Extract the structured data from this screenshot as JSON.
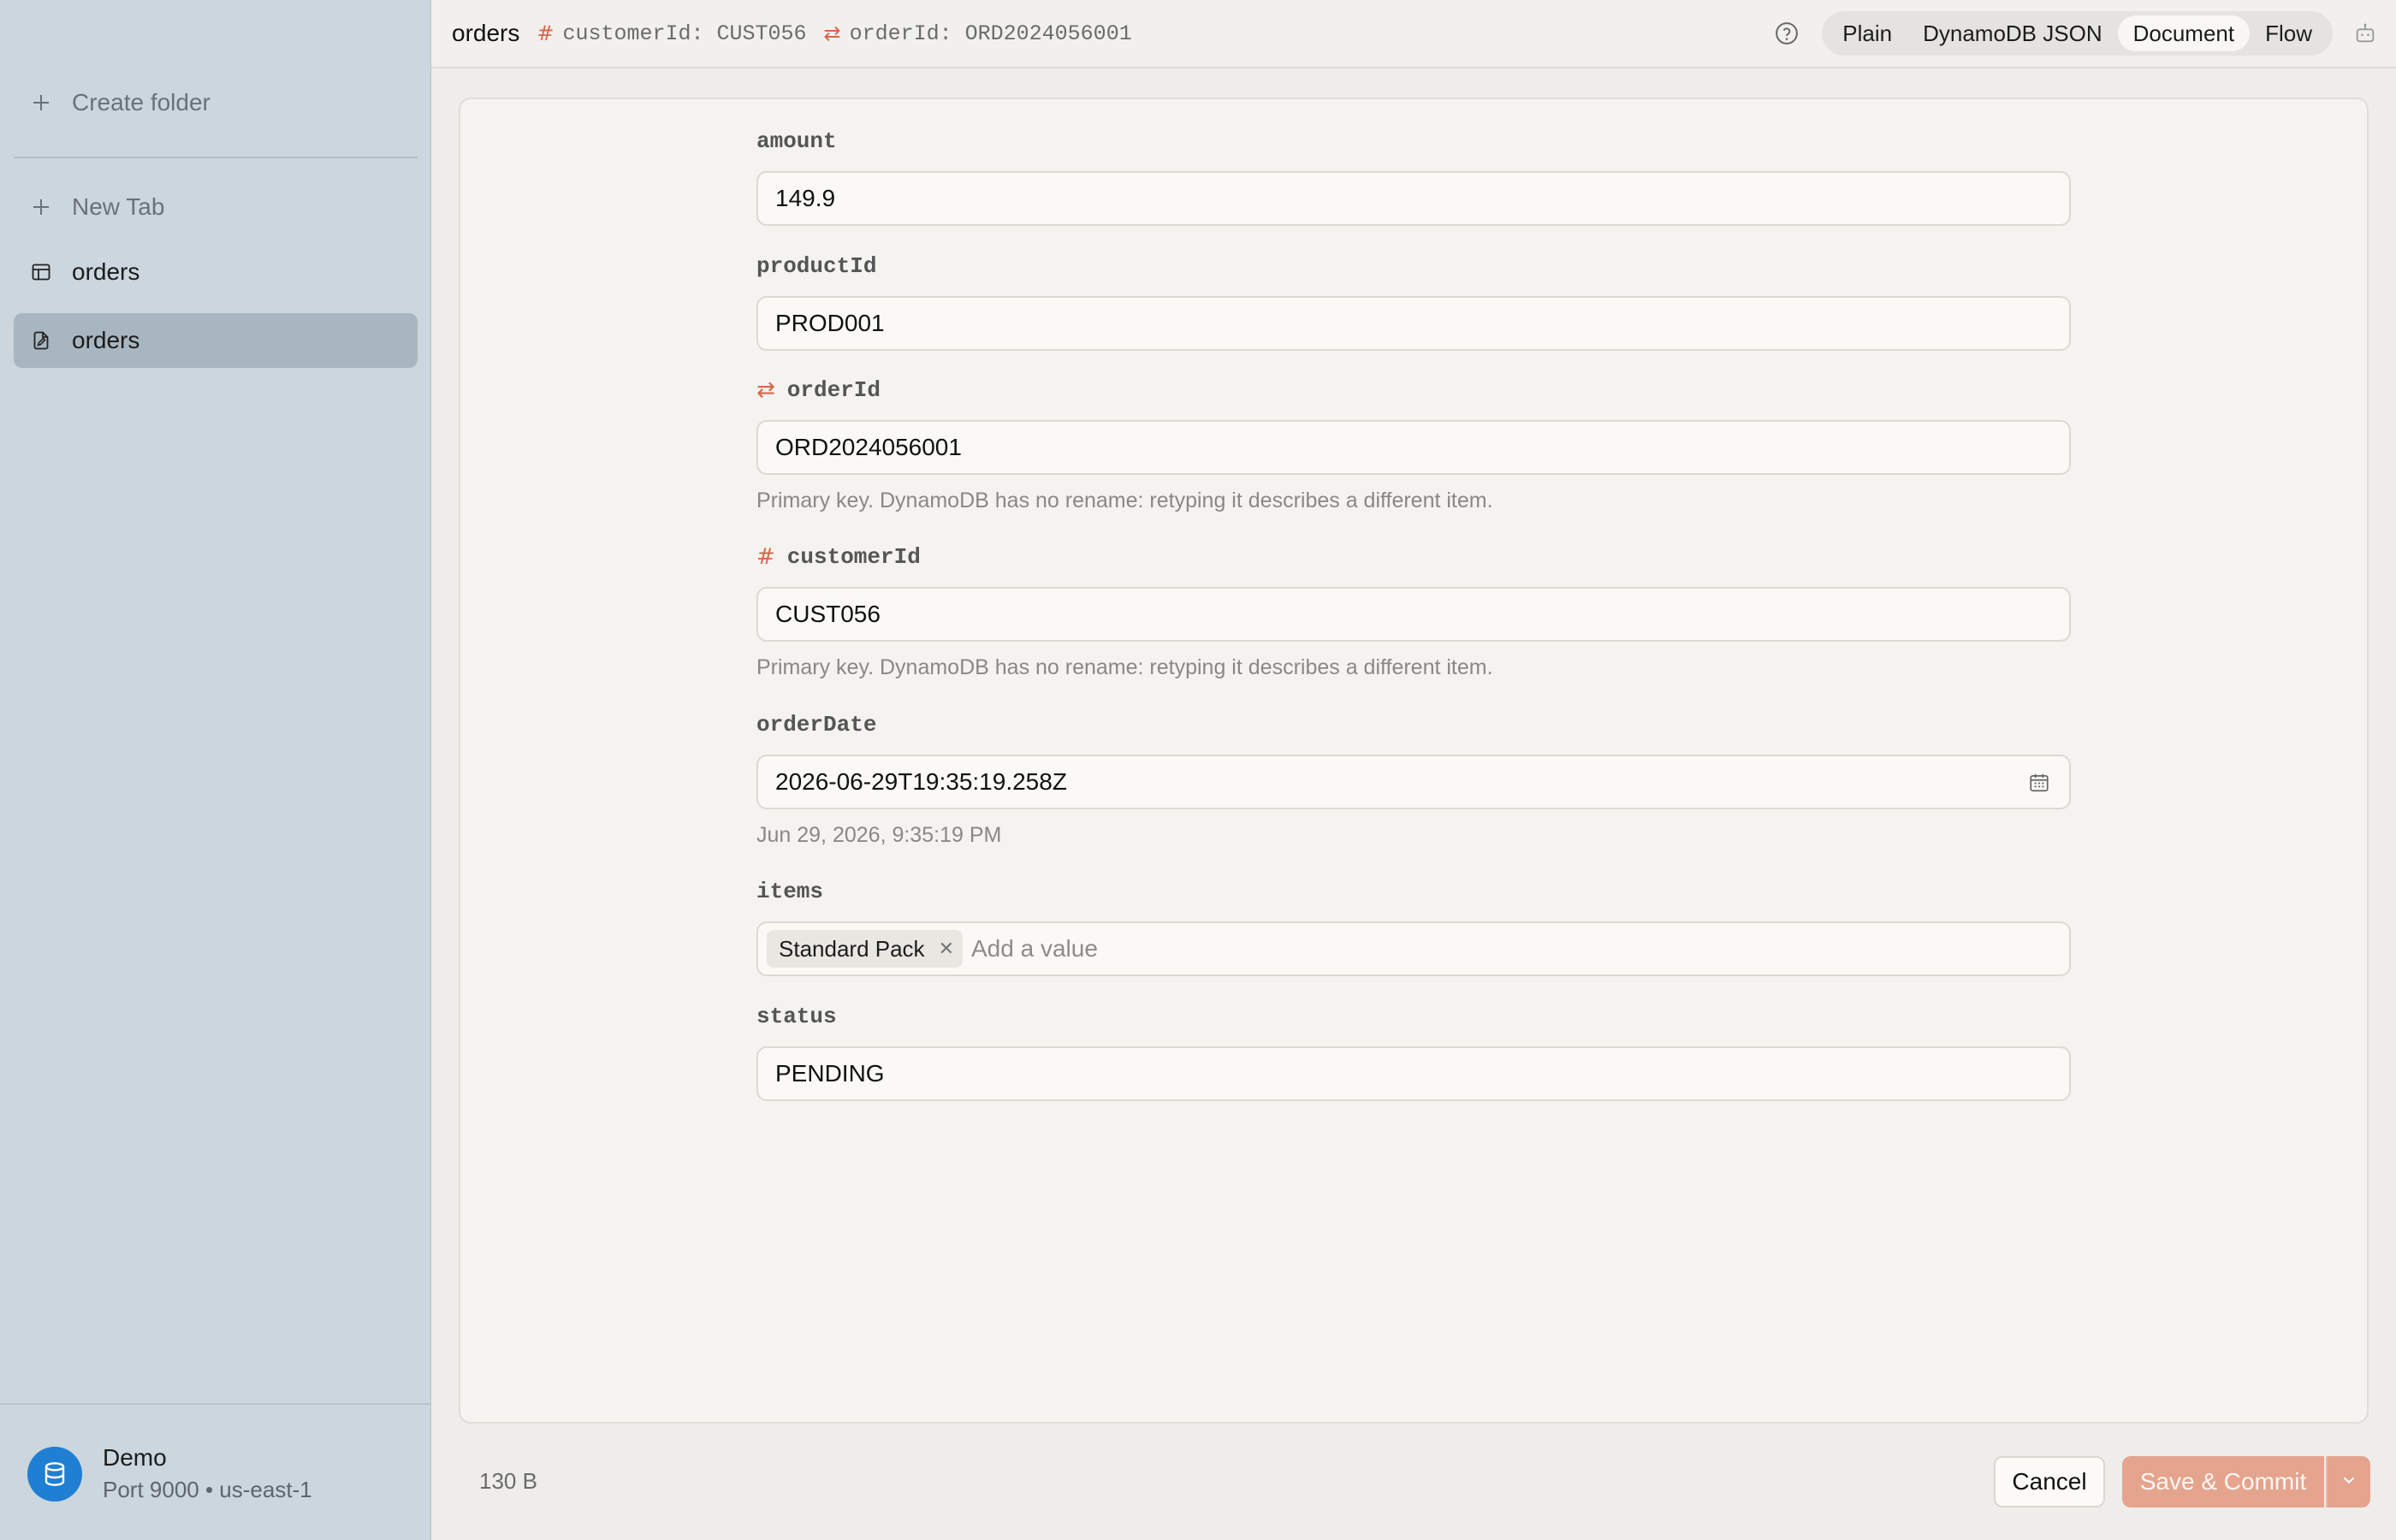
{
  "sidebar": {
    "create_folder": "Create folder",
    "new_tab": "New Tab",
    "items": [
      {
        "label": "orders",
        "icon": "table-icon"
      },
      {
        "label": "orders",
        "icon": "document-edit-icon"
      }
    ],
    "account": {
      "name": "Demo",
      "sub": "Port 9000 • us-east-1",
      "icon": "database-icon"
    }
  },
  "header": {
    "title": "orders",
    "keys": [
      {
        "symbol": "#",
        "text": "customerId: CUST056"
      },
      {
        "symbol": "⇄",
        "text": "orderId: ORD2024056001"
      }
    ],
    "views": [
      "Plain",
      "DynamoDB JSON",
      "Document",
      "Flow"
    ],
    "active_view": "Document"
  },
  "fields": [
    {
      "label": "amount",
      "value": "149.9"
    },
    {
      "label": "productId",
      "value": "PROD001"
    },
    {
      "label": "orderId",
      "symbol": "⇄",
      "value": "ORD2024056001",
      "hint": "Primary key. DynamoDB has no rename: retyping it describes a different item."
    },
    {
      "label": "customerId",
      "symbol": "#",
      "value": "CUST056",
      "hint": "Primary key. DynamoDB has no rename: retyping it describes a different item."
    },
    {
      "label": "orderDate",
      "value": "2026-06-29T19:35:19.258Z",
      "hint": "Jun 29, 2026, 9:35:19 PM"
    },
    {
      "label": "items",
      "chips": [
        "Standard Pack"
      ],
      "placeholder": "Add a value"
    },
    {
      "label": "status",
      "value": "PENDING"
    }
  ],
  "footer": {
    "size": "130 B",
    "cancel_label": "Cancel",
    "save_label": "Save & Commit"
  },
  "colors": {
    "accent": "#d8654a",
    "save_button": "#e4a48d",
    "sidebar": "#cbd6de",
    "avatar": "#1f7fd2"
  }
}
